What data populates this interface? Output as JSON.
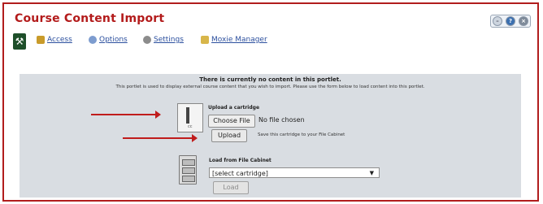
{
  "window": {
    "title": "Course Content Import",
    "controls": [
      "minimize-icon",
      "help-icon",
      "close-icon"
    ]
  },
  "toolbar": {
    "links": [
      {
        "label": "Access",
        "icon": "key-icon"
      },
      {
        "label": "Options",
        "icon": "options-icon"
      },
      {
        "label": "Settings",
        "icon": "gear-icon"
      },
      {
        "label": "Moxie Manager",
        "icon": "folder-icon"
      }
    ]
  },
  "portlet": {
    "heading": "There is currently no content in this portlet.",
    "description": "This portlet is used to display external course content that you wish to import. Please use the form below to load content into this portlet.",
    "upload": {
      "label": "Upload a cartridge",
      "choose_button": "Choose File",
      "file_status": "No file chosen",
      "upload_button": "Upload",
      "note": "Save this cartridge to your File Cabinet"
    },
    "cabinet": {
      "label": "Load from File Cabinet",
      "select_value": "[select cartridge]",
      "load_button": "Load"
    }
  },
  "colors": {
    "accent": "#b31b1b",
    "panel": "#d9dde2",
    "link": "#2b4f9e"
  }
}
